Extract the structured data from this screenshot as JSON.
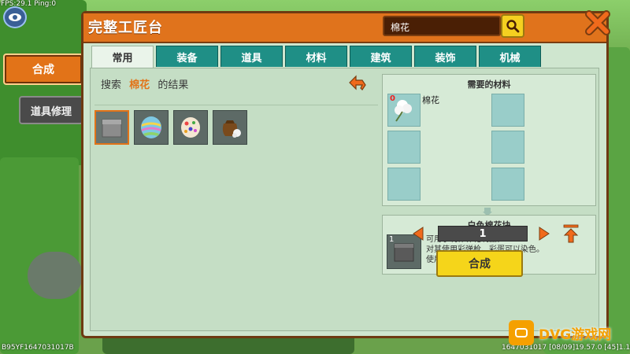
{
  "hud": {
    "top_left": "FPS:29.1 Ping:0",
    "bottom_left": "B95YF1647031017B",
    "bottom_right": "1647031017   [08/09]19.57.0   [45]1.16.1"
  },
  "side_tabs": {
    "craft": "合成",
    "repair": "道具修理"
  },
  "window": {
    "title": "完整工匠台",
    "search_value": "棉花"
  },
  "tabs": [
    "常用",
    "装备",
    "道具",
    "材料",
    "建筑",
    "装饰",
    "机械"
  ],
  "search": {
    "prefix": "搜索",
    "keyword": "棉花",
    "suffix": "的结果"
  },
  "items": [
    {
      "icon": "white-cotton-block-icon",
      "selected": true
    },
    {
      "icon": "rainbow-egg-icon",
      "selected": false
    },
    {
      "icon": "dotted-egg-icon",
      "selected": false
    },
    {
      "icon": "cotton-sack-icon",
      "selected": false
    }
  ],
  "materials": {
    "title": "需要的材料",
    "first": {
      "name": "棉花",
      "count": "0"
    }
  },
  "result": {
    "title": "白色棉花块",
    "count": "1",
    "desc_line1": "可用于制作棉花制品。",
    "desc_line2": "对其使用彩弹枪、彩蛋可以染色。",
    "desc_line3": "使用棉花合成而来。"
  },
  "quantity": "1",
  "craft_button": "合成",
  "watermark": "DVG游戏网",
  "colors": {
    "title_bar": "#e0731c",
    "tab": "#1f8f86",
    "craft": "#f5d51a",
    "panel": "#c5dec5"
  }
}
